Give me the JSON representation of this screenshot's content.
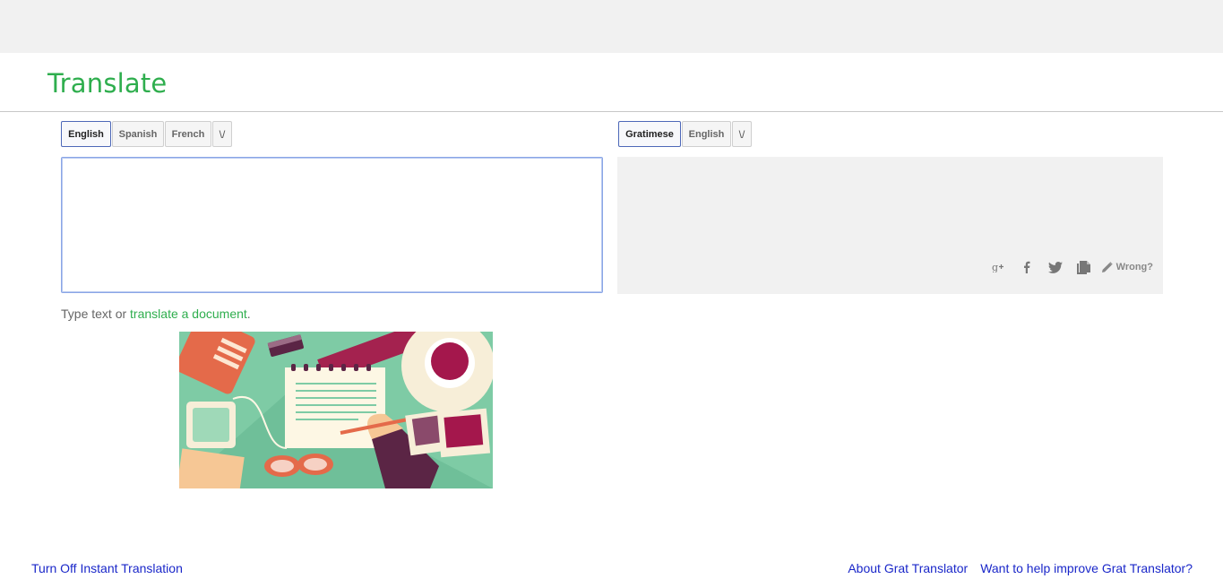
{
  "app": {
    "title": "Translate"
  },
  "source": {
    "languages": [
      "English",
      "Spanish",
      "French"
    ],
    "more_label": "\\/",
    "input_value": "",
    "hint_prefix": "Type text or ",
    "hint_link": "translate a document",
    "hint_suffix": "."
  },
  "target": {
    "languages": [
      "Gratimese",
      "English"
    ],
    "more_label": "\\/",
    "tools": [
      "google-plus-icon",
      "facebook-icon",
      "twitter-icon",
      "copy-icon"
    ],
    "wrong_label": "Wrong?"
  },
  "footer": {
    "instant_toggle": "Turn Off Instant Translation",
    "about": "About Grat Translator",
    "improve": "Want to help improve Grat Translator?"
  },
  "colors": {
    "brand_green": "#2fae4e",
    "link_blue": "#1a27c9",
    "active_border": "#4d68b8"
  }
}
